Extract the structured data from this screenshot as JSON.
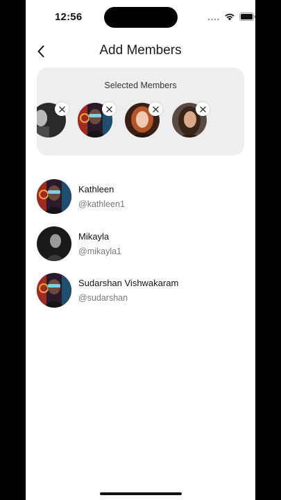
{
  "status_bar": {
    "time": "12:56"
  },
  "header": {
    "title": "Add Members"
  },
  "selected_members": {
    "title": "Selected Members",
    "avatars": [
      "partial-bw-avatar",
      "neon-glasses-avatar",
      "redhead-woman-avatar",
      "brunette-woman-avatar"
    ]
  },
  "users": [
    {
      "name": "Kathleen",
      "handle": "@kathleen1",
      "avatar": "neon-glasses-avatar"
    },
    {
      "name": "Mikayla",
      "handle": "@mikayla1",
      "avatar": "bw-man-avatar"
    },
    {
      "name": "Sudarshan Vishwakaram",
      "handle": "@sudarshan",
      "avatar": "neon-glasses-avatar"
    }
  ],
  "colors": {
    "card_background": "#eeeeee",
    "page_background": "#ffffff",
    "handle_text": "#777777"
  }
}
